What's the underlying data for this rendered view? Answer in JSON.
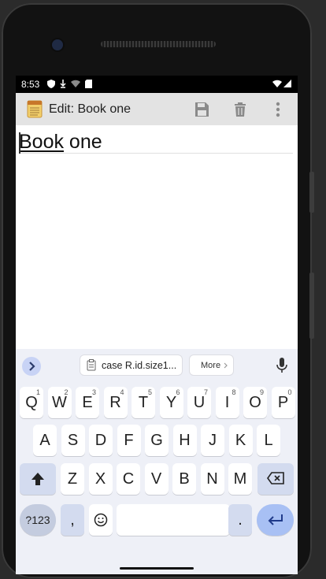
{
  "status": {
    "time": "8:53"
  },
  "appbar": {
    "title": "Edit: Book one"
  },
  "editor": {
    "title_word1": "Book",
    "title_word2": " one"
  },
  "keyboard": {
    "suggestion_chip": "case R.id.size1...",
    "more_label": "More",
    "rows": {
      "row1": [
        {
          "l": "Q",
          "h": "1"
        },
        {
          "l": "W",
          "h": "2"
        },
        {
          "l": "E",
          "h": "3"
        },
        {
          "l": "R",
          "h": "4"
        },
        {
          "l": "T",
          "h": "5"
        },
        {
          "l": "Y",
          "h": "6"
        },
        {
          "l": "U",
          "h": "7"
        },
        {
          "l": "I",
          "h": "8"
        },
        {
          "l": "O",
          "h": "9"
        },
        {
          "l": "P",
          "h": "0"
        }
      ],
      "row2": [
        "A",
        "S",
        "D",
        "F",
        "G",
        "H",
        "J",
        "K",
        "L"
      ],
      "row3": [
        "Z",
        "X",
        "C",
        "V",
        "B",
        "N",
        "M"
      ]
    },
    "sym_label": "?123",
    "comma": ",",
    "period": "."
  }
}
